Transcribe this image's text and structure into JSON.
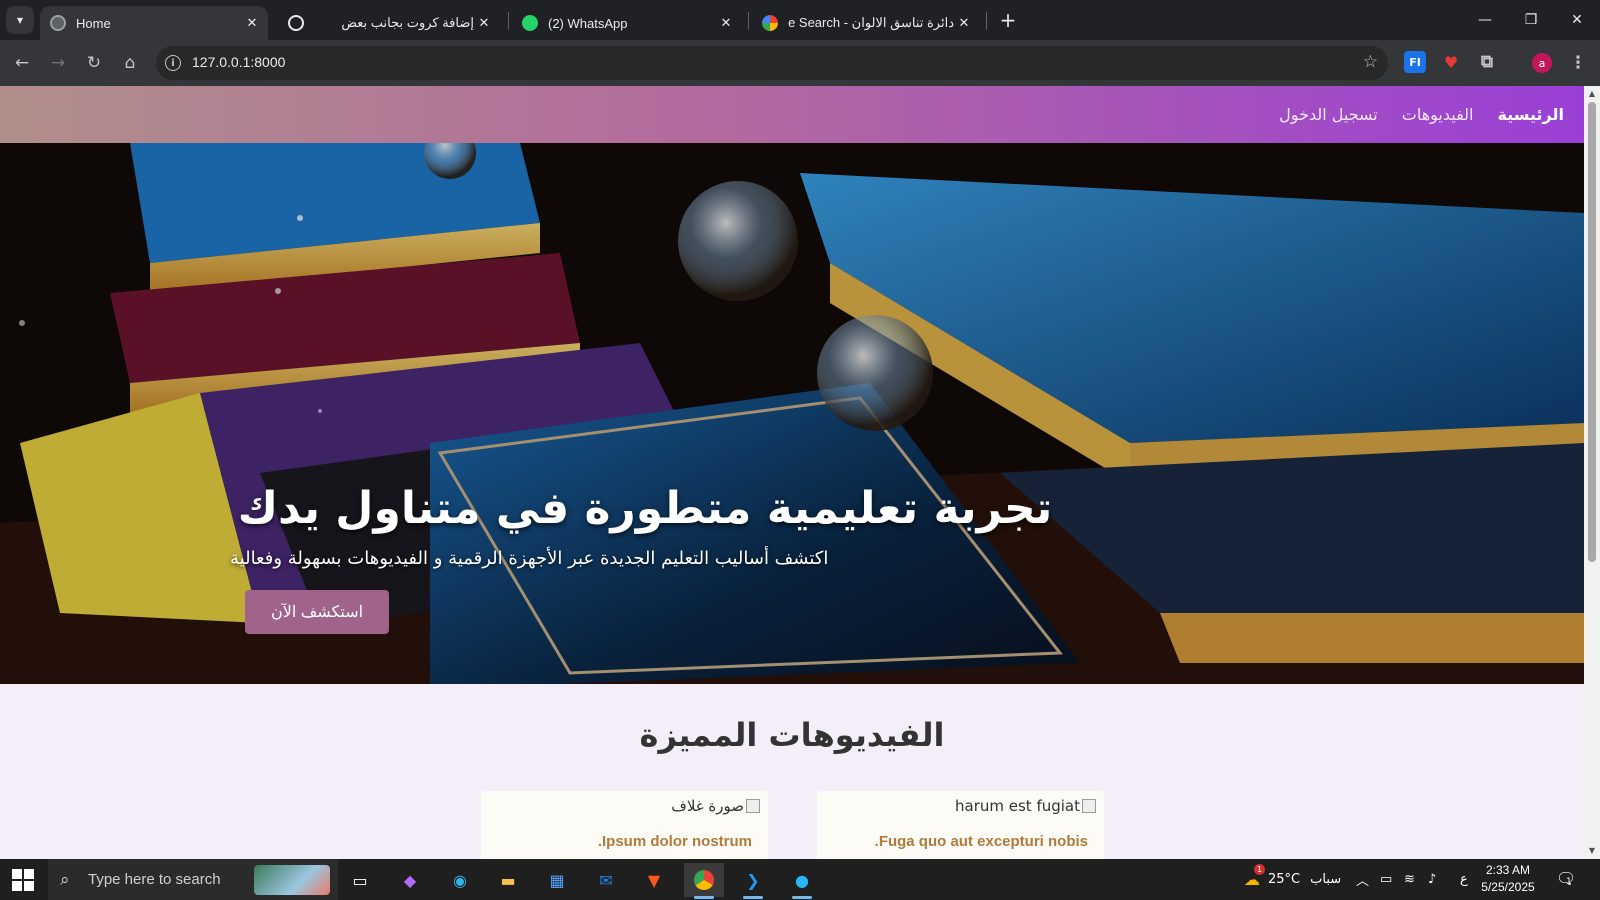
{
  "browser": {
    "tabs": [
      {
        "title": "Home",
        "active": true
      },
      {
        "title": "إضافة كروت بجانب بعض",
        "active": false
      },
      {
        "title": "(2) WhatsApp",
        "active": false
      },
      {
        "title": "دائرة تناسق الالوان - Google Search",
        "active": false
      }
    ],
    "address": "127.0.0.1:8000",
    "profile_initial": "a",
    "extension_label": "FI"
  },
  "site": {
    "nav": {
      "home": "الرئيسية",
      "videos": "الفيديوهات",
      "login": "تسجيل الدخول"
    },
    "hero": {
      "title": "تجربة تعليمية متطورة في متناول يدك",
      "subtitle": "اكتشف أساليب التعليم الجديدة عبر الأجهزة الرقمية و الفيديوهات بسهولة وفعالية",
      "cta": "استكشف الآن"
    },
    "featured": {
      "heading": "الفيديوهات المميزة",
      "cards": [
        {
          "image_alt": "harum est fugiat",
          "title": "Fuga quo aut excepturi nobis."
        },
        {
          "image_alt": "صورة غلاف",
          "title": "Ipsum dolor nostrum."
        }
      ]
    }
  },
  "taskbar": {
    "search_placeholder": "Type here to search",
    "weather": "25°C",
    "weather_text": "سباب",
    "lang": "ع",
    "time": "2:33 AM",
    "date": "5/25/2025",
    "notification_count": "1",
    "weather_badge": "1"
  },
  "colors": {
    "nav_gradient_start": "#b08f8a",
    "nav_gradient_end": "#9a3fd6",
    "cta_button": "#a0648a",
    "card_title": "#b07a3d",
    "page_background": "#f4eef9"
  }
}
